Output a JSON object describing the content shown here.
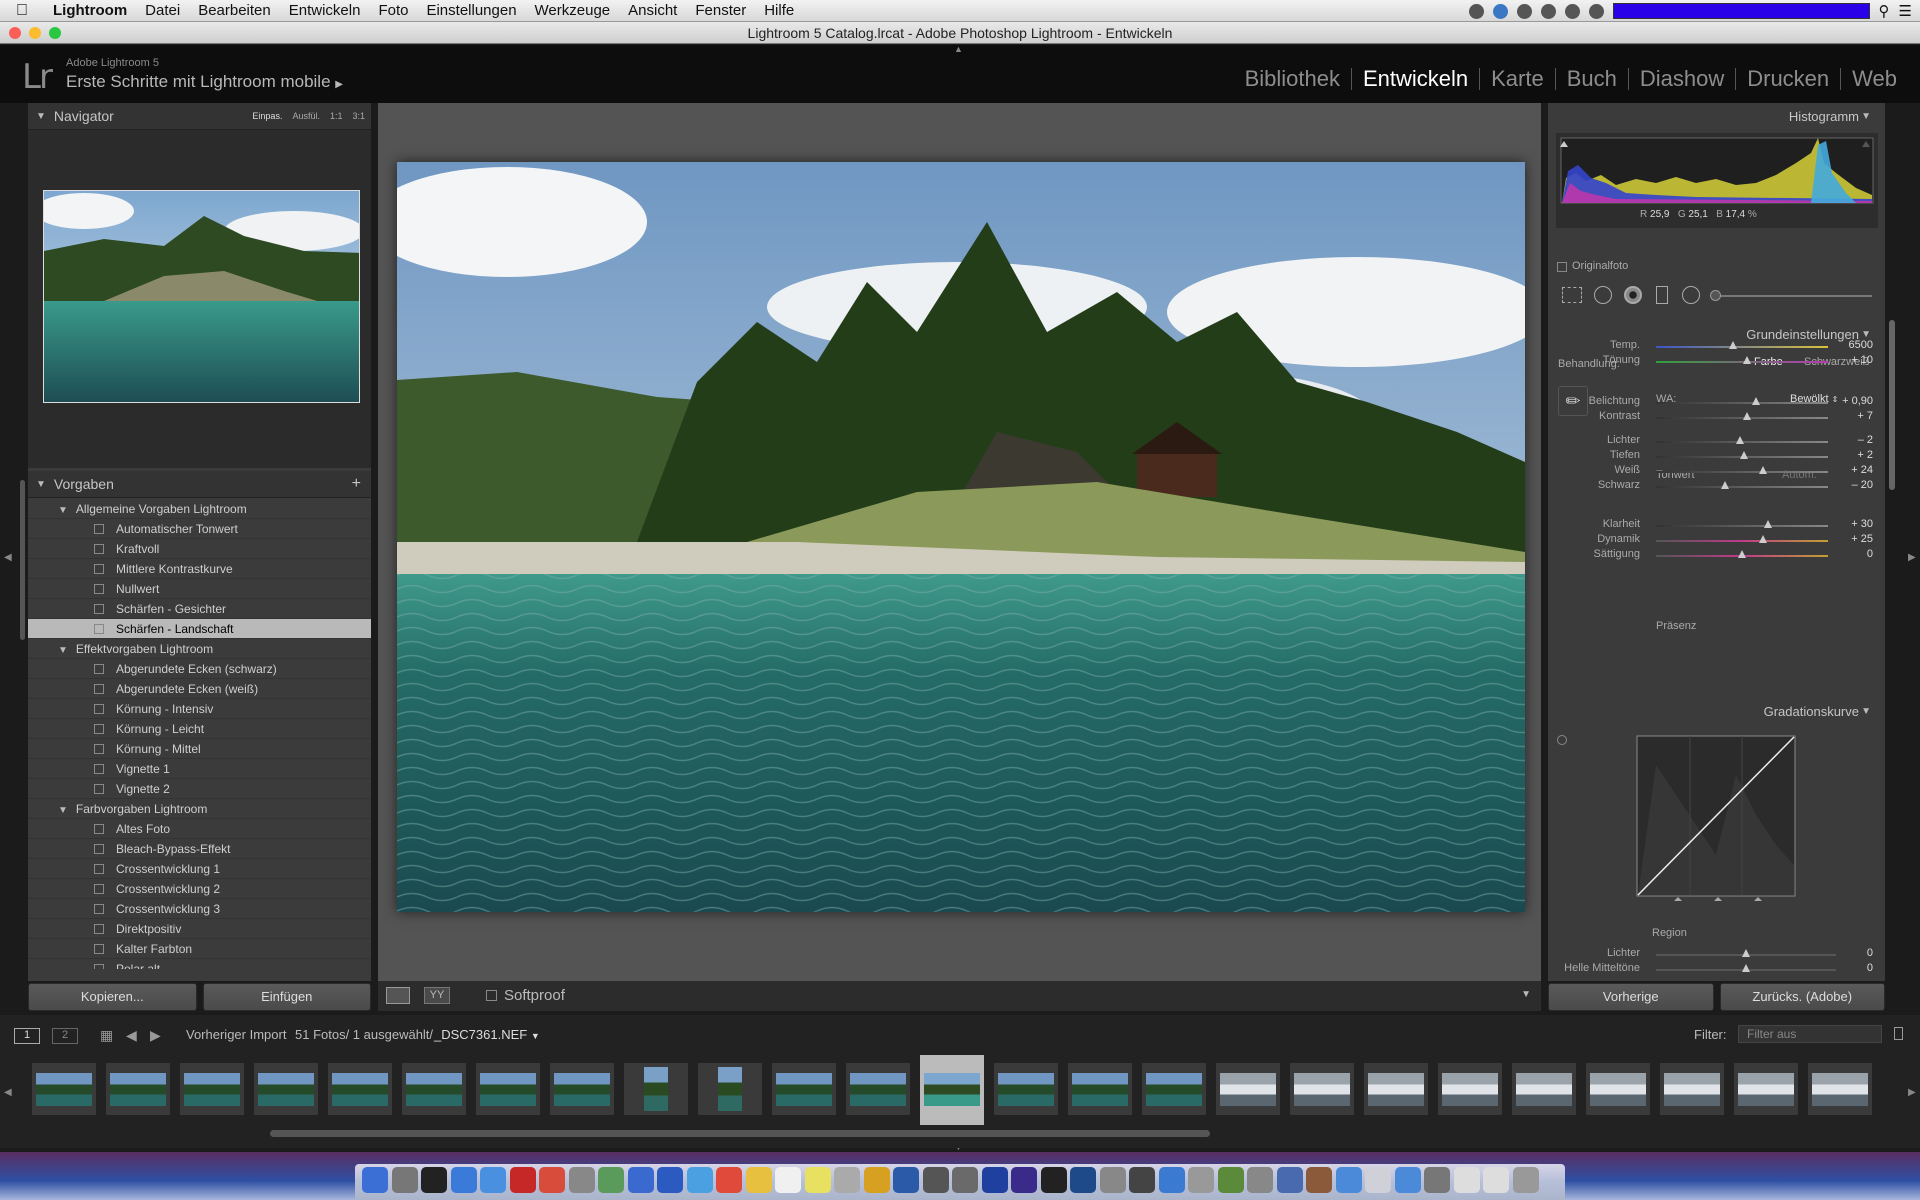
{
  "menubar": {
    "app": "Lightroom",
    "items": [
      "Datei",
      "Bearbeiten",
      "Entwickeln",
      "Foto",
      "Einstellungen",
      "Werkzeuge",
      "Ansicht",
      "Fenster",
      "Hilfe"
    ]
  },
  "window": {
    "title": "Lightroom 5 Catalog.lrcat - Adobe Photoshop Lightroom - Entwickeln"
  },
  "identity": {
    "logo": "Lr",
    "product": "Adobe Lightroom 5",
    "plate": "Erste Schritte mit Lightroom mobile"
  },
  "modules": [
    "Bibliothek",
    "Entwickeln",
    "Karte",
    "Buch",
    "Diashow",
    "Drucken",
    "Web"
  ],
  "navigator": {
    "title": "Navigator",
    "options": [
      "Einpas.",
      "Ausfül.",
      "1:1",
      "3:1"
    ]
  },
  "presets": {
    "title": "Vorgaben",
    "add": "+",
    "rows": [
      {
        "type": "folder",
        "label": "Allgemeine Vorgaben Lightroom"
      },
      {
        "type": "item",
        "label": "Automatischer Tonwert"
      },
      {
        "type": "item",
        "label": "Kraftvoll"
      },
      {
        "type": "item",
        "label": "Mittlere Kontrastkurve"
      },
      {
        "type": "item",
        "label": "Nullwert"
      },
      {
        "type": "item",
        "label": "Schärfen - Gesichter"
      },
      {
        "type": "item",
        "label": "Schärfen - Landschaft",
        "selected": true
      },
      {
        "type": "folder",
        "label": "Effektvorgaben Lightroom"
      },
      {
        "type": "item",
        "label": "Abgerundete Ecken (schwarz)"
      },
      {
        "type": "item",
        "label": "Abgerundete Ecken (weiß)"
      },
      {
        "type": "item",
        "label": "Körnung - Intensiv"
      },
      {
        "type": "item",
        "label": "Körnung - Leicht"
      },
      {
        "type": "item",
        "label": "Körnung - Mittel"
      },
      {
        "type": "item",
        "label": "Vignette 1"
      },
      {
        "type": "item",
        "label": "Vignette 2"
      },
      {
        "type": "folder",
        "label": "Farbvorgaben Lightroom"
      },
      {
        "type": "item",
        "label": "Altes Foto"
      },
      {
        "type": "item",
        "label": "Bleach-Bypass-Effekt"
      },
      {
        "type": "item",
        "label": "Crossentwicklung 1"
      },
      {
        "type": "item",
        "label": "Crossentwicklung 2"
      },
      {
        "type": "item",
        "label": "Crossentwicklung 3"
      },
      {
        "type": "item",
        "label": "Direktpositiv"
      },
      {
        "type": "item",
        "label": "Kalter Farbton"
      },
      {
        "type": "item",
        "label": "Polar alt"
      }
    ]
  },
  "leftButtons": {
    "copy": "Kopieren...",
    "paste": "Einfügen"
  },
  "toolbar": {
    "softproof": "Softproof"
  },
  "histogram": {
    "title": "Histogramm",
    "r_label": "R",
    "r": "25,9",
    "g_label": "G",
    "g": "25,1",
    "b_label": "B",
    "b": "17,4",
    "unit": "%",
    "original": "Originalfoto"
  },
  "basic": {
    "title": "Grundeinstellungen",
    "treatment_label": "Behandlung:",
    "treatment_color": "Farbe",
    "treatment_bw": "Schwarzweiß",
    "wb_label": "WA:",
    "wb_value": "Bewölkt",
    "tone_label": "Tonwert",
    "auto": "Autom.",
    "presence_label": "Präsenz",
    "sliders": [
      {
        "label": "Temp.",
        "value": "6500",
        "pos": 0.45,
        "track": "temp"
      },
      {
        "label": "Tönung",
        "value": "+ 10",
        "pos": 0.53,
        "track": "tint"
      },
      {
        "label": "Belichtung",
        "value": "+ 0,90",
        "pos": 0.58,
        "track": "gray"
      },
      {
        "label": "Kontrast",
        "value": "+ 7",
        "pos": 0.53,
        "track": "gray"
      },
      {
        "label": "Lichter",
        "value": "– 2",
        "pos": 0.49,
        "track": "gray"
      },
      {
        "label": "Tiefen",
        "value": "+ 2",
        "pos": 0.51,
        "track": "gray"
      },
      {
        "label": "Weiß",
        "value": "+ 24",
        "pos": 0.62,
        "track": "gray"
      },
      {
        "label": "Schwarz",
        "value": "– 20",
        "pos": 0.4,
        "track": "gray"
      },
      {
        "label": "Klarheit",
        "value": "+ 30",
        "pos": 0.65,
        "track": "gray"
      },
      {
        "label": "Dynamik",
        "value": "+ 25",
        "pos": 0.62,
        "track": "sat"
      },
      {
        "label": "Sättigung",
        "value": "0",
        "pos": 0.5,
        "track": "sat"
      }
    ]
  },
  "curve": {
    "title": "Gradationskurve",
    "region": "Region",
    "lights_label": "Lichter",
    "lights_value": "0",
    "mid_label": "Helle Mitteltöne",
    "mid_value": "0"
  },
  "rightButtons": {
    "prev": "Vorherige",
    "reset": "Zurücks. (Adobe)"
  },
  "filmbar": {
    "page1": "1",
    "page2": "2",
    "source": "Vorheriger Import",
    "count": "51 Fotos/ 1 ausgewählt/",
    "file": "_DSC7361.NEF",
    "filter_label": "Filter:",
    "filter_value": "Filter aus"
  },
  "colors": {
    "accent": "#2a00e8",
    "panel": "#3b3b3b",
    "selected": "#b9b9b9"
  }
}
